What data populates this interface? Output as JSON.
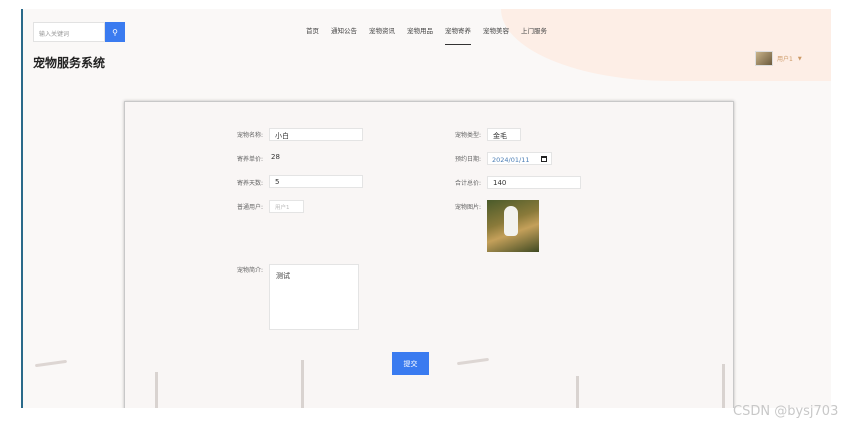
{
  "header": {
    "search_placeholder": "输入关键词",
    "site_title": "宠物服务系统",
    "nav": [
      {
        "label": "首页"
      },
      {
        "label": "通知公告"
      },
      {
        "label": "宠物资讯"
      },
      {
        "label": "宠物用品"
      },
      {
        "label": "宠物寄养",
        "active": true
      },
      {
        "label": "宠物美容"
      },
      {
        "label": "上门服务"
      }
    ],
    "user_name": "用户1"
  },
  "form": {
    "pet_name_label": "宠物名称:",
    "pet_name_value": "小白",
    "pet_type_label": "宠物类型:",
    "pet_type_value": "金毛",
    "unit_price_label": "寄养单价:",
    "unit_price_value": "28",
    "date_label": "预约日期:",
    "date_value": "2024/01/11",
    "days_label": "寄养天数:",
    "days_value": "5",
    "total_label": "合计总价:",
    "total_value": "140",
    "user_label": "普通用户:",
    "user_placeholder": "用户1",
    "photo_label": "宠物图片:",
    "intro_label": "宠物简介:",
    "intro_value": "测试",
    "submit_label": "提交"
  },
  "watermark": "CSDN @bysj703",
  "colors": {
    "accent": "#3a7bf0",
    "header_peach": "#fdeee6"
  }
}
